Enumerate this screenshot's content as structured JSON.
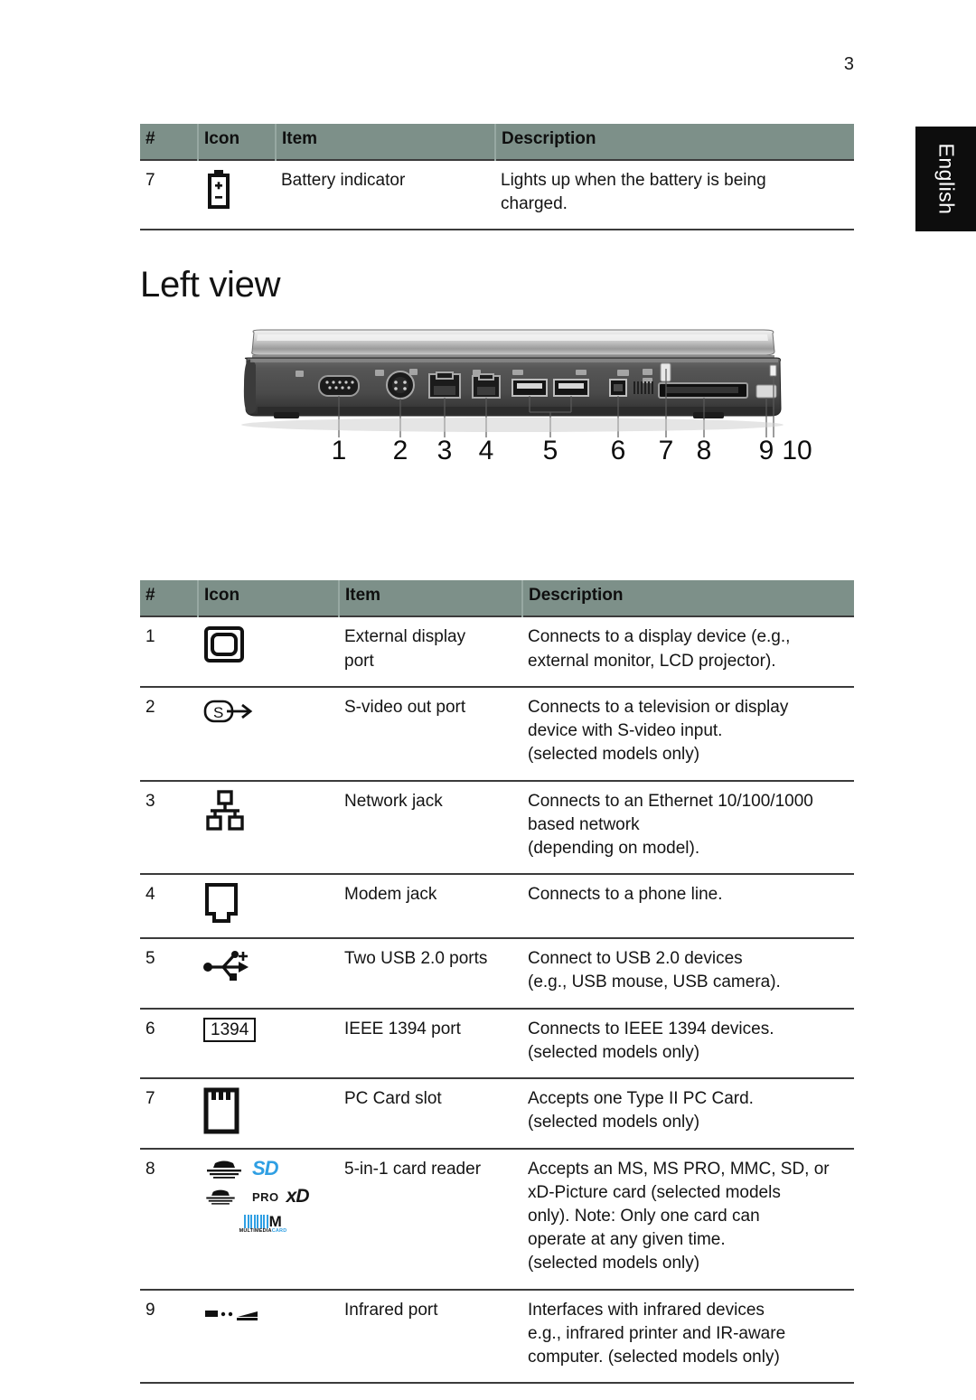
{
  "page": {
    "number": "3",
    "language_tab": "English"
  },
  "table_top": {
    "headers": [
      "#",
      "Icon",
      "Item",
      "Description"
    ],
    "rows": [
      {
        "num": "7",
        "icon": "battery-indicator-icon",
        "item": "Battery indicator",
        "desc_lines": [
          "Lights up when the battery is being",
          "charged."
        ]
      }
    ]
  },
  "section": {
    "heading": "Left view"
  },
  "figure": {
    "name": "laptop-left-side-view",
    "callouts": [
      "1",
      "2",
      "3",
      "4",
      "5",
      "6",
      "7",
      "8",
      "9",
      "10"
    ]
  },
  "table_main": {
    "headers": [
      "#",
      "Icon",
      "Item",
      "Description"
    ],
    "rows": [
      {
        "num": "1",
        "icon": "external-display-port-icon",
        "item_lines": [
          "External display",
          "port"
        ],
        "desc_lines": [
          "Connects to a display device (e.g.,",
          "external monitor, LCD projector)."
        ]
      },
      {
        "num": "2",
        "icon": "s-video-out-icon",
        "item_lines": [
          "S-video out port"
        ],
        "desc_lines": [
          "Connects to a television or display",
          "device with S-video input.",
          "(selected models only)"
        ]
      },
      {
        "num": "3",
        "icon": "network-jack-icon",
        "item_lines": [
          "Network jack"
        ],
        "desc_lines": [
          "Connects to an Ethernet 10/100/1000",
          "based network",
          "(depending on model)."
        ]
      },
      {
        "num": "4",
        "icon": "modem-jack-icon",
        "item_lines": [
          "Modem jack"
        ],
        "desc_lines": [
          "Connects to a phone line."
        ]
      },
      {
        "num": "5",
        "icon": "usb-icon",
        "item_lines": [
          "Two USB 2.0 ports"
        ],
        "desc_lines": [
          "Connect to USB 2.0 devices",
          "(e.g., USB mouse, USB camera)."
        ]
      },
      {
        "num": "6",
        "icon": "ieee-1394-icon",
        "icon_label": "1394",
        "item_lines": [
          "IEEE 1394 port"
        ],
        "desc_lines": [
          "Connects to IEEE 1394 devices.",
          "(selected models only)"
        ]
      },
      {
        "num": "7",
        "icon": "pc-card-slot-icon",
        "item_lines": [
          "PC Card slot"
        ],
        "desc_lines": [
          "Accepts one Type II PC Card.",
          "(selected models only)"
        ]
      },
      {
        "num": "8",
        "icon": "card-reader-logos",
        "icon_labels": [
          "SD",
          "PRO",
          "xD",
          "M",
          "MULTIMEDIACARD"
        ],
        "item_lines": [
          "5-in-1 card reader"
        ],
        "desc_lines": [
          "Accepts an MS, MS PRO, MMC, SD, or",
          "xD-Picture card (selected models",
          "only). Note: Only one card can",
          "operate at any given time.",
          "(selected models only)"
        ]
      },
      {
        "num": "9",
        "icon": "infrared-port-icon",
        "item_lines": [
          "Infrared port"
        ],
        "desc_lines": [
          "Interfaces with infrared devices",
          "e.g., infrared printer and IR-aware",
          "computer. (selected models only)"
        ]
      }
    ]
  },
  "colors": {
    "table_header_bg": "#7d9089",
    "rule": "#3b3b3b",
    "lang_tab_bg": "#0d0d0d",
    "sd_blue": "#2f9fe3"
  }
}
